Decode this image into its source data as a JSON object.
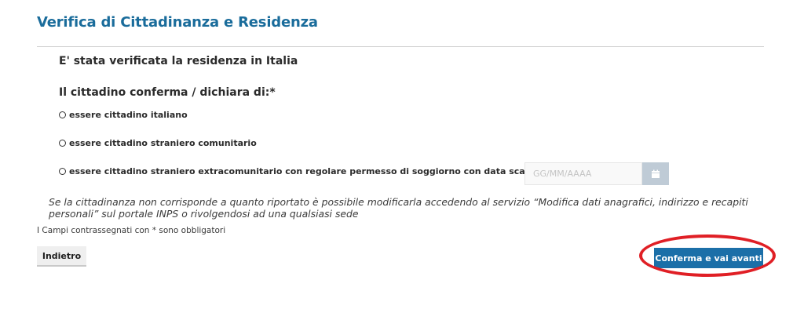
{
  "page": {
    "title": "Verifica di Cittadinanza e Residenza",
    "status_text": "E' stata verificata la residenza in Italia",
    "section_heading": "Il cittadino conferma / dichiara di:*"
  },
  "options": [
    {
      "label": "essere cittadino italiano",
      "selected": false
    },
    {
      "label": "essere cittadino straniero comunitario",
      "selected": false
    },
    {
      "label": "essere cittadino straniero extracomunitario con regolare permesso di soggiorno con data scadenza",
      "selected": false
    }
  ],
  "date_field": {
    "placeholder": "GG/MM/AAAA",
    "value": "",
    "icon": "calendar-icon"
  },
  "info_note": "Se la cittadinanza non corrisponde a quanto riportato è possibile modificarla accedendo al servizio “Modifica dati anagrafici, indirizzo e recapiti personali” sul portale INPS o rivolgendosi ad una qualsiasi sede",
  "required_note": "I Campi contrassegnati con * sono obbligatori",
  "buttons": {
    "back_label": "Indietro",
    "confirm_label": "Conferma e vai avanti"
  },
  "colors": {
    "title": "#1a6c9b",
    "primary_button": "#1b6fa8",
    "calendar_button": "#bfcbd6",
    "highlight_annotation": "#e01f25"
  }
}
